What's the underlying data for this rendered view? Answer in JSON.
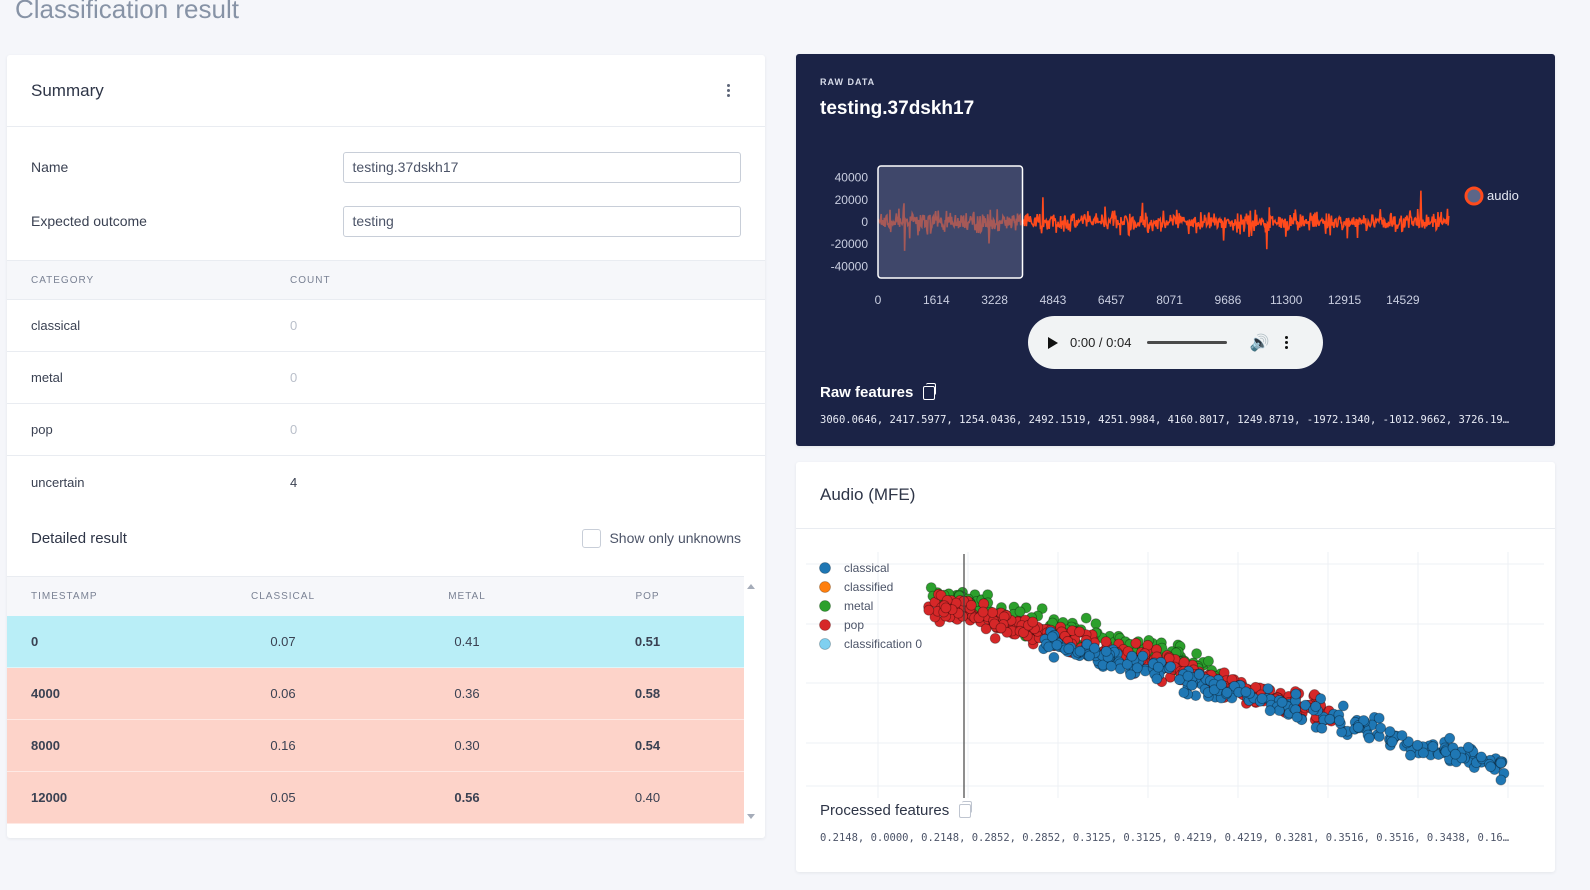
{
  "page": {
    "title": "Classification result"
  },
  "summary": {
    "title": "Summary",
    "name_label": "Name",
    "name_value": "testing.37dskh17",
    "expected_label": "Expected outcome",
    "expected_value": "testing",
    "columns": [
      "CATEGORY",
      "COUNT"
    ],
    "categories": [
      {
        "name": "classical",
        "count": "0"
      },
      {
        "name": "metal",
        "count": "0"
      },
      {
        "name": "pop",
        "count": "0"
      },
      {
        "name": "uncertain",
        "count": "4"
      }
    ],
    "detailed_title": "Detailed result",
    "show_unknowns_label": "Show only unknowns",
    "result_columns": [
      "TIMESTAMP",
      "CLASSICAL",
      "METAL",
      "POP"
    ],
    "results": [
      {
        "timestamp": "0",
        "classical": "0.07",
        "metal": "0.41",
        "pop": "0.51"
      },
      {
        "timestamp": "4000",
        "classical": "0.06",
        "metal": "0.36",
        "pop": "0.58"
      },
      {
        "timestamp": "8000",
        "classical": "0.16",
        "metal": "0.30",
        "pop": "0.54"
      },
      {
        "timestamp": "12000",
        "classical": "0.05",
        "metal": "0.56",
        "pop": "0.40"
      }
    ]
  },
  "raw": {
    "label": "RAW DATA",
    "title": "testing.37dskh17",
    "player_time": "0:00 / 0:04",
    "features_title": "Raw features",
    "features_values": "3060.0646, 2417.5977, 1254.0436, 2492.1519, 4251.9984, 4160.8017, 1249.8719, -1972.1340, -1012.9662, 3726.19…"
  },
  "mfe": {
    "title": "Audio (MFE)",
    "processed_title": "Processed features",
    "processed_values": "0.2148, 0.0000, 0.2148, 0.2852, 0.2852, 0.3125, 0.3125, 0.4219, 0.4219, 0.3281, 0.3516, 0.3516, 0.3438, 0.16…"
  },
  "colors": {
    "waveform": "#ff4a1c",
    "window_fill": "#5c6688",
    "classical": "#1f77b4",
    "classified": "#ff7f0e",
    "metal": "#2ca02c",
    "pop": "#d62728",
    "classification_0": "#7fd0f0"
  },
  "chart_data": [
    {
      "type": "line",
      "series": [
        {
          "name": "audio"
        }
      ],
      "y_ticks": [
        "40000",
        "20000",
        "0",
        "-20000",
        "-40000"
      ],
      "x_ticks": [
        "0",
        "1614",
        "3228",
        "4843",
        "6457",
        "8071",
        "9686",
        "11300",
        "12915",
        "14529"
      ],
      "ylim": [
        -45000,
        45000
      ],
      "xlim": [
        0,
        16000
      ],
      "window": [
        0,
        4000
      ]
    },
    {
      "type": "scatter",
      "legend": [
        "classical",
        "classified",
        "metal",
        "pop",
        "classification 0"
      ],
      "clusters": [
        {
          "label": "classical",
          "x_range": [
            0.2,
            1.0
          ],
          "y_range": [
            0.1,
            0.55
          ],
          "count": 260
        },
        {
          "label": "metal",
          "x_range": [
            0.0,
            0.55
          ],
          "y_range": [
            0.45,
            0.95
          ],
          "count": 120
        },
        {
          "label": "pop",
          "x_range": [
            0.0,
            0.7
          ],
          "y_range": [
            0.35,
            0.95
          ],
          "count": 360
        }
      ],
      "vertical_marker_x": 0.05
    }
  ]
}
